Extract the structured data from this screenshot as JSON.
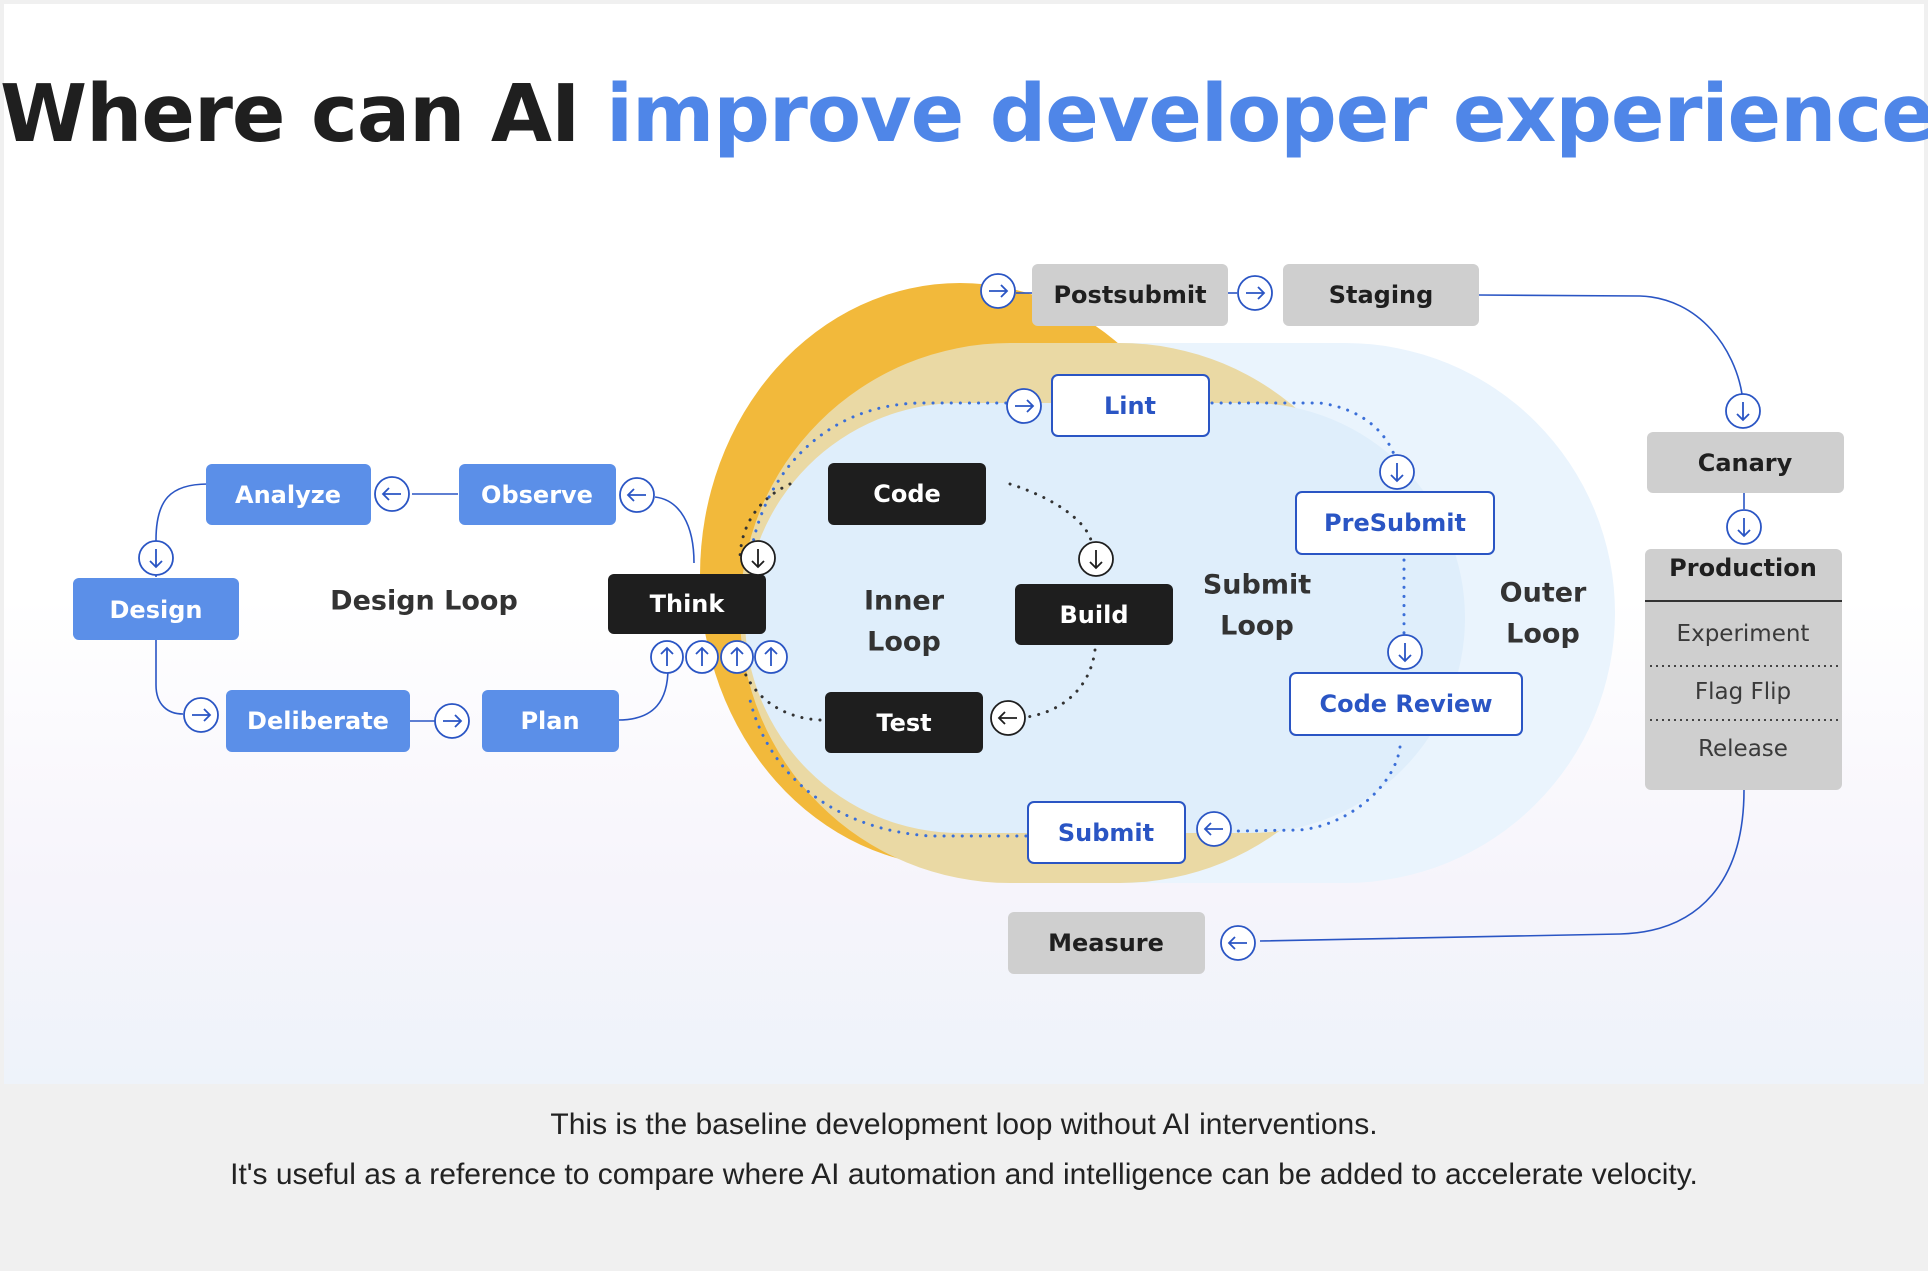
{
  "title": {
    "part1": "Where can AI",
    "part2": "improve developer experience?"
  },
  "colors": {
    "accent": "#4f86e8",
    "design_node": "#5b8fe8",
    "inner_node": "#1e1e1e",
    "gray_node": "#cfcfcf",
    "outline_blue": "#2a55c4",
    "orange_ring": "#f2b93b",
    "tan_ring": "#ead9a4",
    "light_blue": "#dfeefb",
    "lighter_blue": "#eaf4fd"
  },
  "labels": {
    "design_loop": "Design Loop",
    "inner_loop": [
      "Inner",
      "Loop"
    ],
    "submit_loop": [
      "Submit",
      "Loop"
    ],
    "outer_loop": [
      "Outer",
      "Loop"
    ]
  },
  "design_nodes": {
    "analyze": "Analyze",
    "observe": "Observe",
    "design": "Design",
    "deliberate": "Deliberate",
    "plan": "Plan"
  },
  "inner_nodes": {
    "think": "Think",
    "code": "Code",
    "build": "Build",
    "test": "Test"
  },
  "submit_nodes": {
    "lint": "Lint",
    "presubmit": "PreSubmit",
    "code_review": "Code Review",
    "submit": "Submit"
  },
  "outer_nodes": {
    "postsubmit": "Postsubmit",
    "staging": "Staging",
    "canary": "Canary",
    "measure": "Measure"
  },
  "production": {
    "header": "Production",
    "items": [
      "Experiment",
      "Flag Flip",
      "Release"
    ]
  },
  "arrow_icons": [
    "arrow-right-icon",
    "arrow-left-icon",
    "arrow-down-icon",
    "arrow-up-icon"
  ],
  "caption": {
    "line1": "This is the baseline development loop without AI interventions.",
    "line2": "It's useful as a reference to compare where AI automation and intelligence can be added to accelerate velocity."
  }
}
